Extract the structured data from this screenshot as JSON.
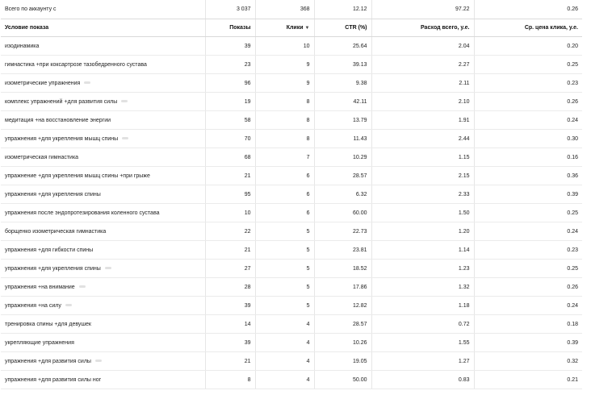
{
  "total": {
    "label": "Всего по аккаунту с",
    "shows": "3 037",
    "clicks": "368",
    "ctr": "12.12",
    "spend": "97.22",
    "cpc": "0.26"
  },
  "columns": {
    "condition": "Условие показа",
    "shows": "Показы",
    "clicks": "Клики",
    "ctr": "CTR (%)",
    "spend": "Расход всего, у.е.",
    "cpc": "Ср. цена клика, у.е."
  },
  "rows": [
    {
      "condition": "изодинамика",
      "shows": "39",
      "clicks": "10",
      "ctr": "25.64",
      "spend": "2.04",
      "cpc": "0.20",
      "tag": false
    },
    {
      "condition": "гимнастика +при коксартрозе тазобедренного сустава",
      "shows": "23",
      "clicks": "9",
      "ctr": "39.13",
      "spend": "2.27",
      "cpc": "0.25",
      "tag": false
    },
    {
      "condition": "изометрические упражнения",
      "shows": "96",
      "clicks": "9",
      "ctr": "9.38",
      "spend": "2.11",
      "cpc": "0.23",
      "tag": true
    },
    {
      "condition": "комплекс упражнений +для развития силы",
      "shows": "19",
      "clicks": "8",
      "ctr": "42.11",
      "spend": "2.10",
      "cpc": "0.26",
      "tag": true
    },
    {
      "condition": "медитация +на восстановление энергии",
      "shows": "58",
      "clicks": "8",
      "ctr": "13.79",
      "spend": "1.91",
      "cpc": "0.24",
      "tag": false
    },
    {
      "condition": "упражнения +для укрепления мышц спины",
      "shows": "70",
      "clicks": "8",
      "ctr": "11.43",
      "spend": "2.44",
      "cpc": "0.30",
      "tag": true
    },
    {
      "condition": "изометрическая гимнастика",
      "shows": "68",
      "clicks": "7",
      "ctr": "10.29",
      "spend": "1.15",
      "cpc": "0.16",
      "tag": false
    },
    {
      "condition": "упражнение +для укрепления мышц спины +при грыже",
      "shows": "21",
      "clicks": "6",
      "ctr": "28.57",
      "spend": "2.15",
      "cpc": "0.36",
      "tag": false
    },
    {
      "condition": "упражнения +для укрепления спины",
      "shows": "95",
      "clicks": "6",
      "ctr": "6.32",
      "spend": "2.33",
      "cpc": "0.39",
      "tag": false
    },
    {
      "condition": "упражнения после эндопротезирования коленного сустава",
      "shows": "10",
      "clicks": "6",
      "ctr": "60.00",
      "spend": "1.50",
      "cpc": "0.25",
      "tag": false
    },
    {
      "condition": "борщенко изометрическая гимнастика",
      "shows": "22",
      "clicks": "5",
      "ctr": "22.73",
      "spend": "1.20",
      "cpc": "0.24",
      "tag": false
    },
    {
      "condition": "упражнения +для гибкости спины",
      "shows": "21",
      "clicks": "5",
      "ctr": "23.81",
      "spend": "1.14",
      "cpc": "0.23",
      "tag": false
    },
    {
      "condition": "упражнения +для укрепления спины",
      "shows": "27",
      "clicks": "5",
      "ctr": "18.52",
      "spend": "1.23",
      "cpc": "0.25",
      "tag": true
    },
    {
      "condition": "упражнения +на внимание",
      "shows": "28",
      "clicks": "5",
      "ctr": "17.86",
      "spend": "1.32",
      "cpc": "0.26",
      "tag": true
    },
    {
      "condition": "упражнения +на силу",
      "shows": "39",
      "clicks": "5",
      "ctr": "12.82",
      "spend": "1.18",
      "cpc": "0.24",
      "tag": true
    },
    {
      "condition": "тренировка спины +для девушек",
      "shows": "14",
      "clicks": "4",
      "ctr": "28.57",
      "spend": "0.72",
      "cpc": "0.18",
      "tag": false
    },
    {
      "condition": "укрепляющие упражнения",
      "shows": "39",
      "clicks": "4",
      "ctr": "10.26",
      "spend": "1.55",
      "cpc": "0.39",
      "tag": false
    },
    {
      "condition": "упражнения +для развития силы",
      "shows": "21",
      "clicks": "4",
      "ctr": "19.05",
      "spend": "1.27",
      "cpc": "0.32",
      "tag": true
    },
    {
      "condition": "упражнения +для развития силы ног",
      "shows": "8",
      "clicks": "4",
      "ctr": "50.00",
      "spend": "0.83",
      "cpc": "0.21",
      "tag": false
    }
  ]
}
